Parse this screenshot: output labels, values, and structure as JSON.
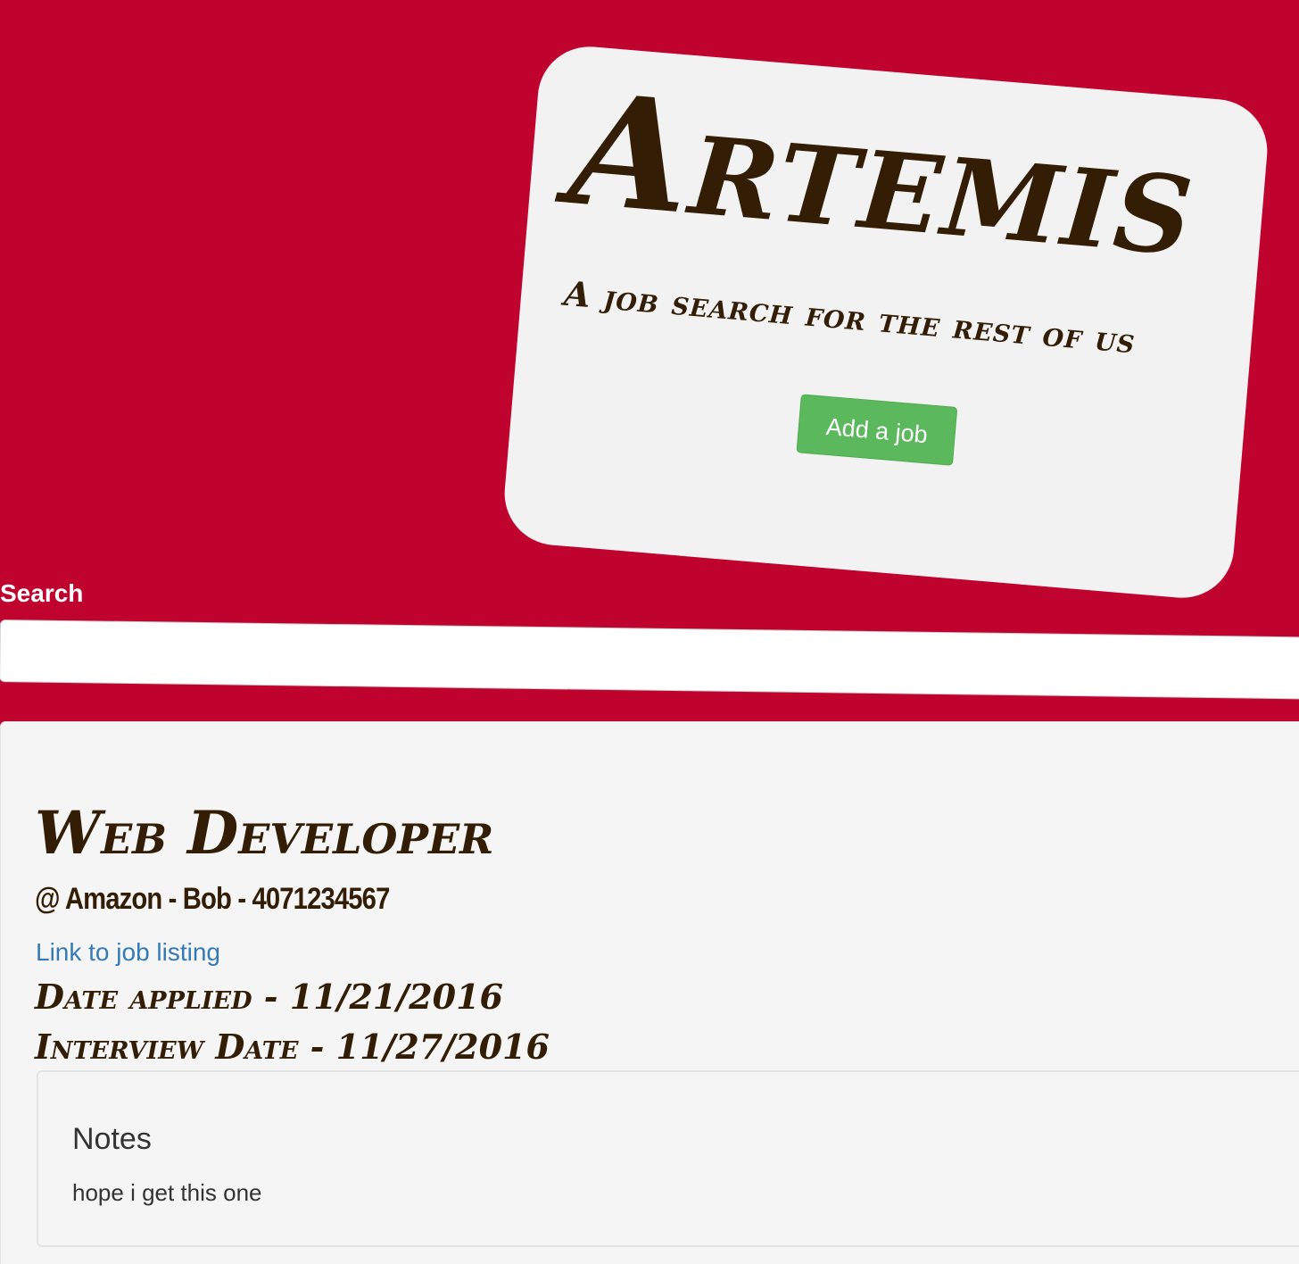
{
  "hero": {
    "title": "Artemis",
    "tagline": "A job search for the rest of us",
    "add_job_label": "Add a job"
  },
  "search": {
    "label": "Search",
    "value": "",
    "placeholder": ""
  },
  "job": {
    "title": "Web Developer",
    "company_line": "@ Amazon - Bob - 4071234567",
    "link_label": "Link to job listing",
    "date_applied": "Date applied - 11/21/2016",
    "interview_date": "Interview Date - 11/27/2016",
    "notes": {
      "heading": "Notes",
      "text": "hope i get this one"
    }
  },
  "colors": {
    "background": "#c0022e",
    "card": "#f2f2f2",
    "title_text": "#331d04",
    "button": "#5cb85c",
    "link": "#337ab7"
  }
}
